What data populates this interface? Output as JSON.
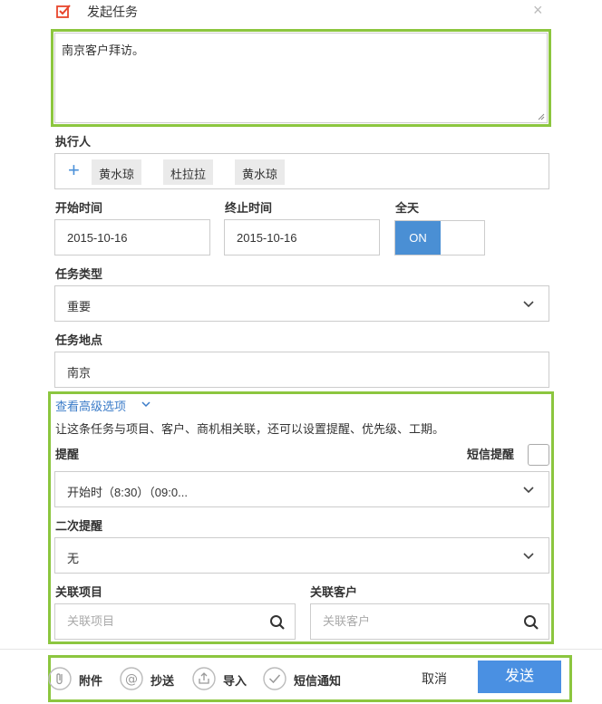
{
  "header": {
    "title": "发起任务",
    "close": "×",
    "icon": "check-box-icon",
    "accent": "#e8452c"
  },
  "description": {
    "value": "南京客户拜访。"
  },
  "executor": {
    "label": "执行人",
    "chips": [
      "黄水琼",
      "杜拉拉",
      "黄水琼"
    ]
  },
  "start_time": {
    "label": "开始时间",
    "value": "2015-10-16"
  },
  "end_time": {
    "label": "终止时间",
    "value": "2015-10-16"
  },
  "all_day": {
    "label": "全天",
    "state": "ON"
  },
  "task_type": {
    "label": "任务类型",
    "value": "重要"
  },
  "location": {
    "label": "任务地点",
    "value": "南京"
  },
  "advanced": {
    "link": "查看高级选项",
    "desc": "让这条任务与项目、客户、商机相关联，还可以设置提醒、优先级、工期。",
    "reminder": {
      "label": "提醒",
      "value": "开始时（8:30）（09:0..."
    },
    "sms_reminder": {
      "label": "短信提醒"
    },
    "second_reminder": {
      "label": "二次提醒",
      "value": "无"
    },
    "project": {
      "label": "关联项目",
      "placeholder": "关联项目"
    },
    "customer": {
      "label": "关联客户",
      "placeholder": "关联客户"
    }
  },
  "footer": {
    "attach": "附件",
    "cc": "抄送",
    "import": "导入",
    "sms_notify": "短信通知",
    "cancel": "取消",
    "send": "发送"
  },
  "colors": {
    "highlight": "#8cc63f",
    "primary": "#4a90e2",
    "link": "#3a7bc8"
  }
}
